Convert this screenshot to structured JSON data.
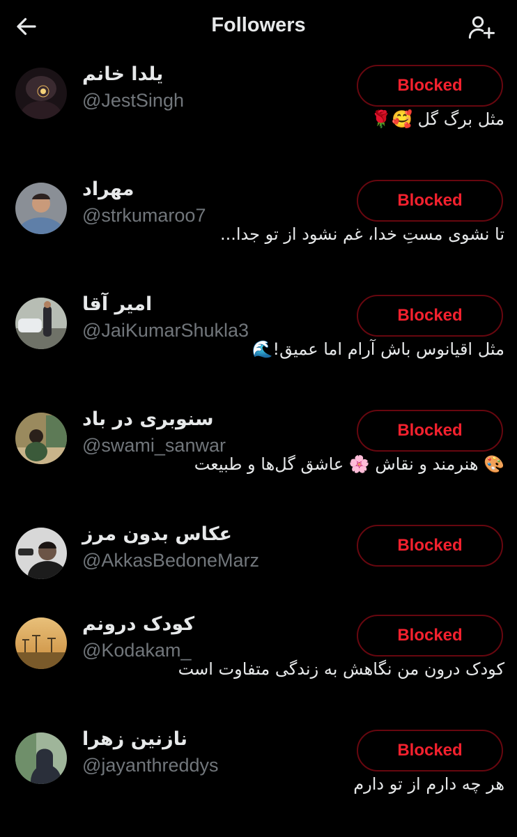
{
  "header": {
    "title": "Followers",
    "back_icon": "arrow-left-icon",
    "add_icon": "add-user-icon"
  },
  "colors": {
    "background": "#000000",
    "text_primary": "#e7e9ea",
    "text_secondary": "#71767b",
    "blocked_text": "#f4212e",
    "blocked_border": "#67070f"
  },
  "followers": [
    {
      "name": "یلدا خانم",
      "handle": "@JestSingh",
      "button": "Blocked",
      "bio": "مثل برگ گل 🥰🌹"
    },
    {
      "name": "مهراد",
      "handle": "@strkumaroo7",
      "button": "Blocked",
      "bio": "تا نشوی مستِ خدا، غم نشود از تو جدا..."
    },
    {
      "name": "امیر آقا",
      "handle": "@JaiKumarShukla3",
      "button": "Blocked",
      "bio": "مثل اقیانوس باش آرام اما عمیق!🌊"
    },
    {
      "name": "سنوبری در باد",
      "handle": "@swami_sanwar",
      "button": "Blocked",
      "bio": "🎨 هنرمند و نقاش 🌸 عاشق گل‌ها و طبیعت"
    },
    {
      "name": "عکاس بدون مرز",
      "handle": "@AkkasBedoneMarz",
      "button": "Blocked",
      "bio": ""
    },
    {
      "name": "کودک درونم",
      "handle": "@Kodakam_",
      "button": "Blocked",
      "bio": "کودک درون من نگاهش به زندگی متفاوت است"
    },
    {
      "name": "نازنین زهرا",
      "handle": "@jayanthreddys",
      "button": "Blocked",
      "bio": "هر چه دارم از تو دارم"
    }
  ]
}
